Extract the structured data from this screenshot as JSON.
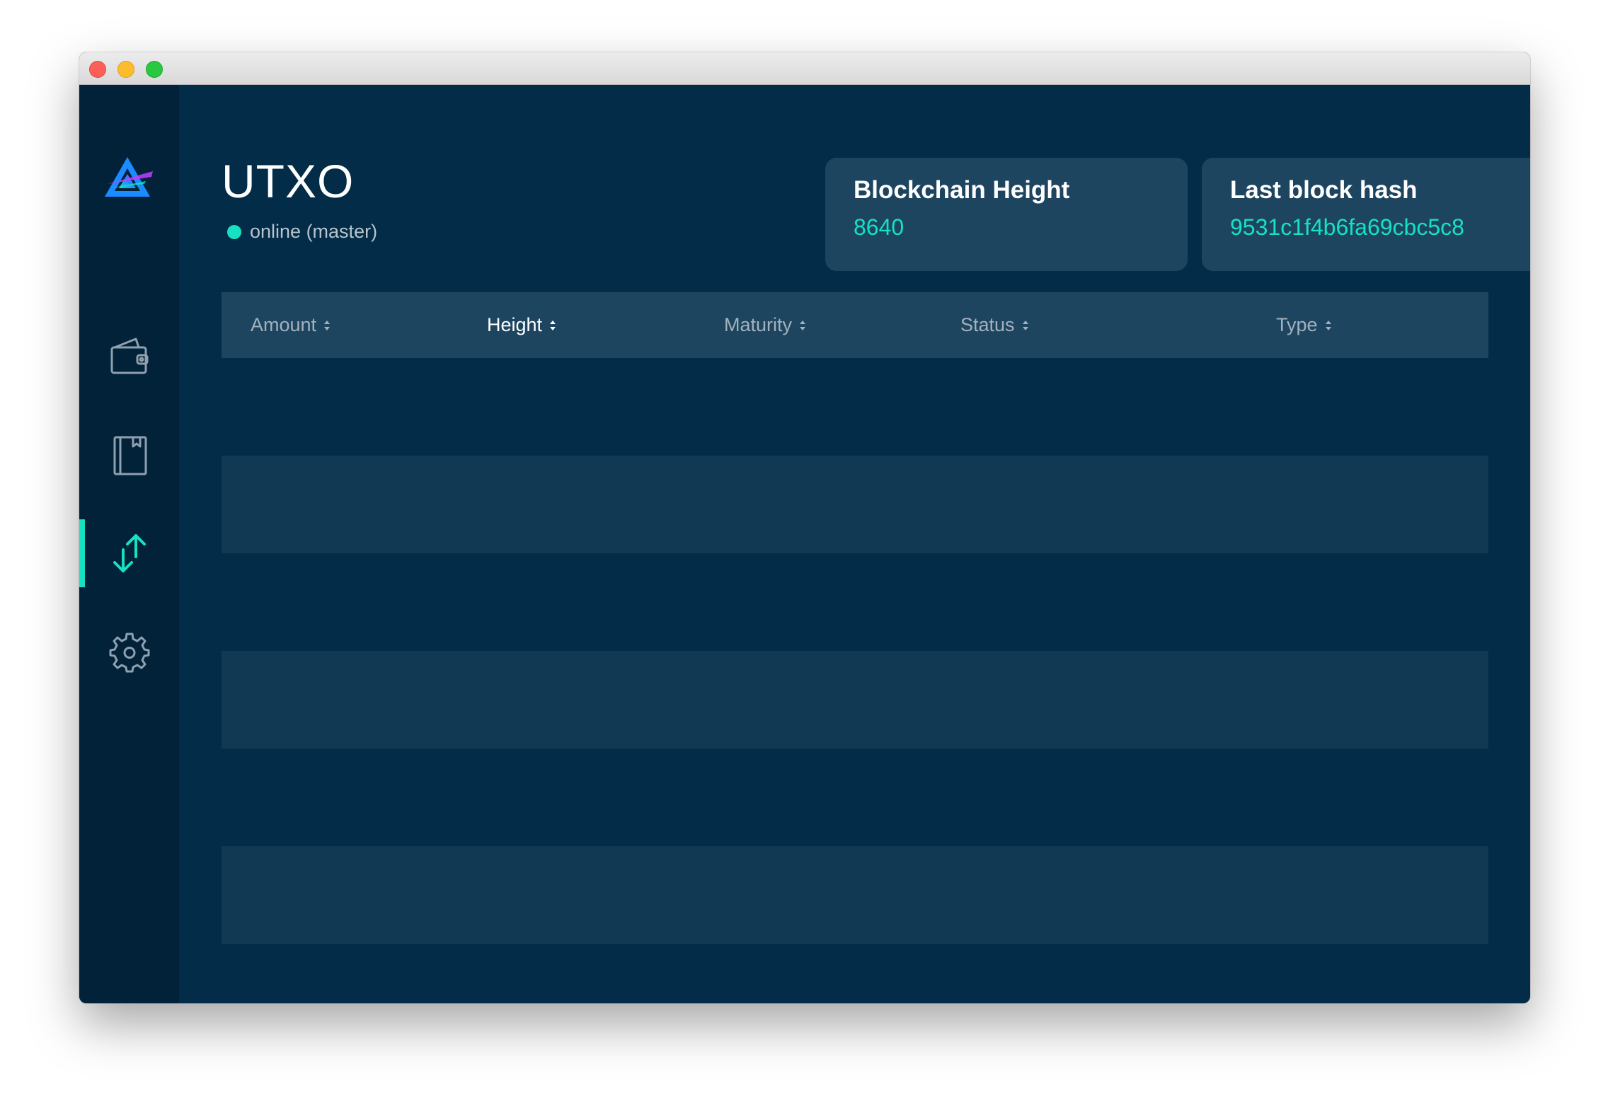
{
  "window": {
    "controls": [
      "close",
      "minimize",
      "maximize"
    ]
  },
  "sidebar": {
    "logo": "triangle-logo-icon",
    "items": [
      {
        "id": "wallet",
        "icon": "wallet-icon",
        "active": false
      },
      {
        "id": "address-book",
        "icon": "notebook-icon",
        "active": false
      },
      {
        "id": "utxo",
        "icon": "arrows-up-down-icon",
        "active": true
      },
      {
        "id": "settings",
        "icon": "gear-icon",
        "active": false
      }
    ],
    "accent_color": "#17e1c3"
  },
  "header": {
    "title": "UTXO",
    "status_text": "online (master)",
    "status_color": "#17e1c3"
  },
  "cards": {
    "blockchain_height": {
      "title": "Blockchain Height",
      "value": "8640"
    },
    "last_block_hash": {
      "title": "Last block hash",
      "value": "9531c1f4b6fa69cbc5c8"
    }
  },
  "table": {
    "columns": [
      {
        "label": "Amount",
        "active": false
      },
      {
        "label": "Height",
        "active": true
      },
      {
        "label": "Maturity",
        "active": false
      },
      {
        "label": "Status",
        "active": false
      },
      {
        "label": "Type",
        "active": false
      }
    ],
    "rows": []
  },
  "colors": {
    "background": "#022c47",
    "sidebar": "#02223a",
    "card": "#1d4560",
    "row_alt": "#123954",
    "accent": "#17e1c3"
  }
}
